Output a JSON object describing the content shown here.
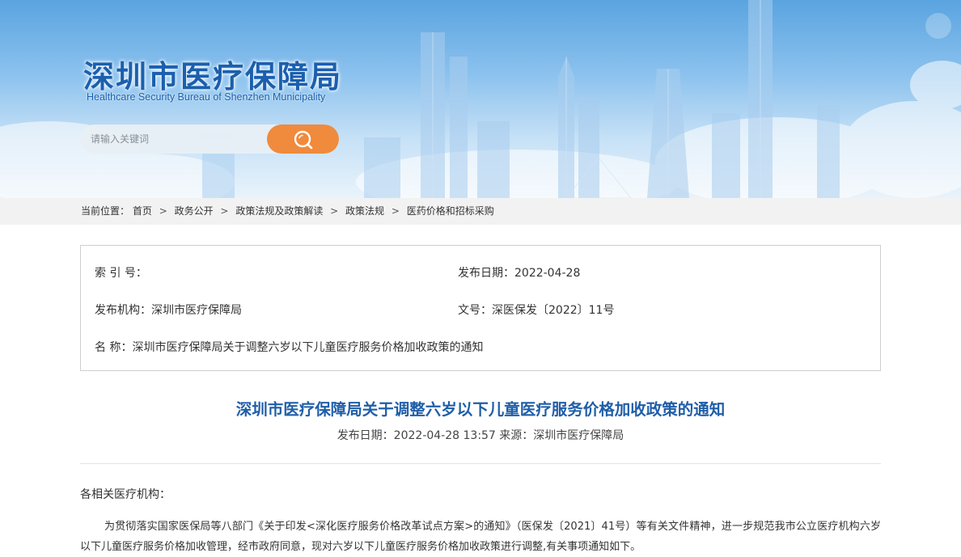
{
  "site": {
    "name_cn": "深圳市医疗保障局",
    "name_en": "Healthcare Security Bureau of Shenzhen Municipality"
  },
  "search": {
    "placeholder": "请输入关键词",
    "value": "",
    "button_icon": "search-icon"
  },
  "breadcrumb": {
    "prefix": "当前位置：",
    "items": [
      "首页",
      "政务公开",
      "政策法规及政策解读",
      "政策法规",
      "医药价格和招标采购"
    ],
    "separator": ">"
  },
  "info": {
    "index_label": "索 引 号：",
    "index_value": "",
    "publish_date_label": "发布日期：",
    "publish_date_value": "2022-04-28",
    "org_label": "发布机构：",
    "org_value": "深圳市医疗保障局",
    "doc_no_label": "文号：",
    "doc_no_value": "深医保发〔2022〕11号",
    "name_label": "名 称：",
    "name_value": "深圳市医疗保障局关于调整六岁以下儿童医疗服务价格加收政策的通知"
  },
  "article": {
    "title": "深圳市医疗保障局关于调整六岁以下儿童医疗服务价格加收政策的通知",
    "meta": "发布日期：2022-04-28 13:57 来源：深圳市医疗保障局",
    "salutation": "各相关医疗机构：",
    "paragraph_1": "为贯彻落实国家医保局等八部门《关于印发<深化医疗服务价格改革试点方案>的通知》（医保发〔2021〕41号）等有关文件精神，进一步规范我市公立医疗机构六岁以下儿童医疗服务价格加收管理，经市政府同意，现对六岁以下儿童医疗服务价格加收政策进行调整,有关事项通知如下。"
  },
  "colors": {
    "brand_blue": "#1b5fae",
    "title_blue": "#1f5ea8",
    "search_orange": "#f08a3c",
    "crumb_bg": "#f2f2f2"
  }
}
